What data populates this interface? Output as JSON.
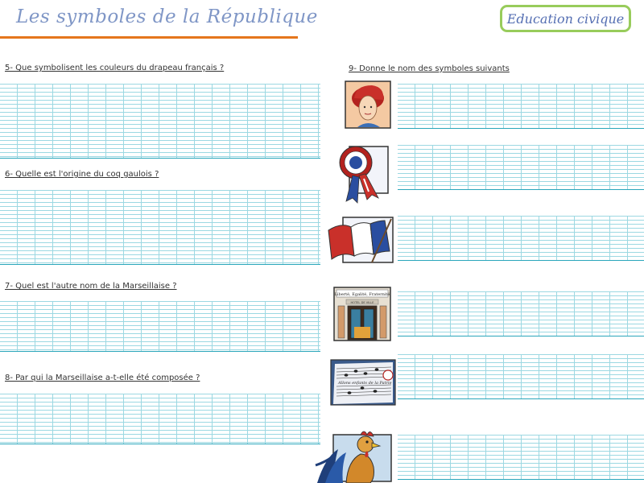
{
  "header": {
    "title": "Les symboles de la République",
    "subject": "Education civique"
  },
  "questions": [
    {
      "text": "5- Que symbolisent les couleurs du drapeau français ?"
    },
    {
      "text": "6- Quelle est l'origine du coq gaulois ?"
    },
    {
      "text": "7- Quel est l'autre nom de la Marseillaise ?"
    },
    {
      "text": "8- Par qui la Marseillaise a-t-elle été composée ?"
    },
    {
      "text": "9- Donne le nom des symboles suivants"
    }
  ],
  "symbols": {
    "marianne": "marianne",
    "cocarde": "cocarde",
    "drapeau": "drapeau",
    "mairie": "mairie",
    "mairie_banner": "Liberté, Egalité, Fraternité",
    "mairie_plaque": "HOTEL DE VILLE",
    "marseillaise": "partition",
    "marseillaise_lyrics": "Allons enfants de la Patrie",
    "coq": "coq"
  },
  "colors": {
    "title": "#7f96c6",
    "title_rule": "#e5761c",
    "badge_border": "#98cc5b",
    "badge_text": "#556fb3",
    "writing_lines": "#2aa6bb"
  }
}
